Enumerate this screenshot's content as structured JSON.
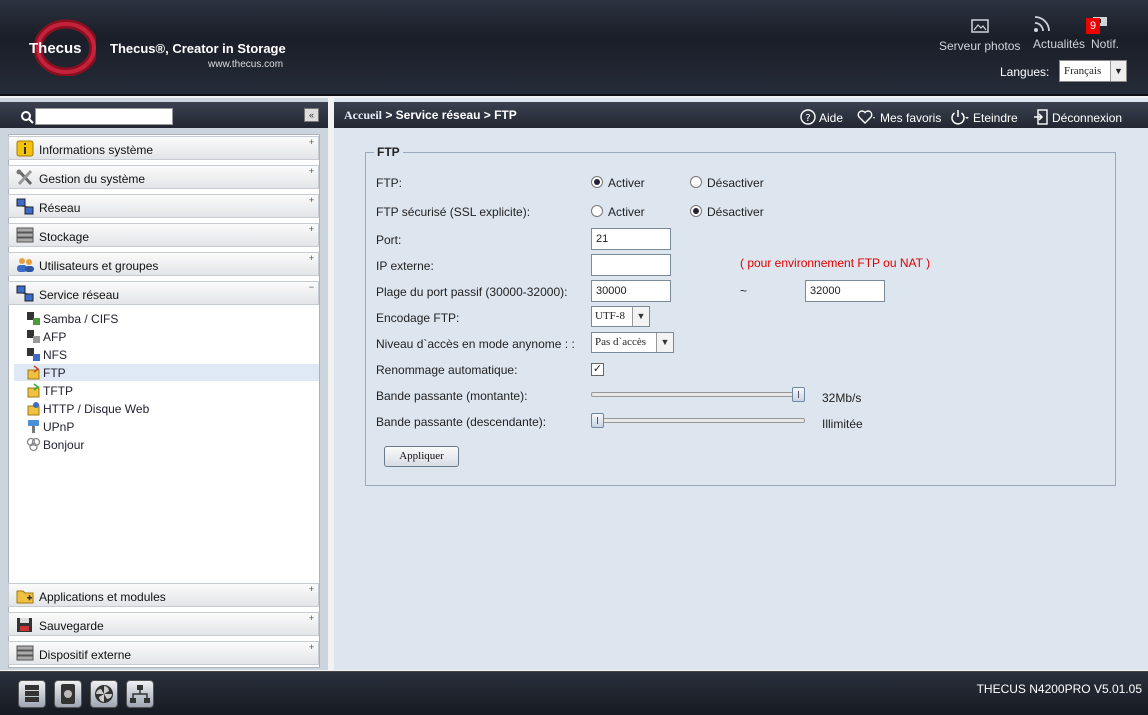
{
  "header": {
    "logo": "Thecus",
    "tagline": "Thecus®, Creator in Storage",
    "website": "www.thecus.com",
    "photo_server": "Serveur photos",
    "news": "Actualités",
    "notifications": "Notif.",
    "notif_count": "9",
    "lang_label": "Langues:",
    "lang_value": "Français"
  },
  "sidebar": {
    "search_placeholder": "",
    "categories_top": [
      {
        "label": "Informations système",
        "toggle": "+"
      },
      {
        "label": "Gestion du système",
        "toggle": "+"
      },
      {
        "label": "Réseau",
        "toggle": "+"
      },
      {
        "label": "Stockage",
        "toggle": "+"
      },
      {
        "label": "Utilisateurs et groupes",
        "toggle": "+"
      },
      {
        "label": "Service réseau",
        "toggle": "−"
      }
    ],
    "subitems": [
      {
        "label": "Samba / CIFS"
      },
      {
        "label": "AFP"
      },
      {
        "label": "NFS"
      },
      {
        "label": "FTP"
      },
      {
        "label": "TFTP"
      },
      {
        "label": "HTTP / Disque Web"
      },
      {
        "label": "UPnP"
      },
      {
        "label": "Bonjour"
      }
    ],
    "categories_bottom": [
      {
        "label": "Applications et modules",
        "toggle": "+"
      },
      {
        "label": "Sauvegarde",
        "toggle": "+"
      },
      {
        "label": "Dispositif externe",
        "toggle": "+"
      }
    ]
  },
  "breadcrumb": {
    "home": "Accueil",
    "path": " > Service réseau > FTP"
  },
  "toolbar": {
    "help": "Aide",
    "favorites": "Mes favoris",
    "shutdown": "Eteindre",
    "logout": "Déconnexion"
  },
  "form": {
    "legend": "FTP",
    "ftp_label": "FTP:",
    "ftp_on": "Activer",
    "ftp_off": "Désactiver",
    "ssl_label": "FTP sécurisé (SSL explicite):",
    "ssl_on": "Activer",
    "ssl_off": "Désactiver",
    "port_label": "Port:",
    "port_value": "21",
    "ip_label": "IP externe:",
    "ip_value": "",
    "ip_note": "( pour environnement FTP ou NAT )",
    "passive_label": "Plage du port passif (30000-32000):",
    "passive_from": "30000",
    "passive_sep": "~",
    "passive_to": "32000",
    "encoding_label": "Encodage FTP:",
    "encoding_value": "UTF-8",
    "anon_label": "Niveau d`accès en mode anynome : :",
    "anon_value": "Pas d`accès",
    "rename_label": "Renommage automatique:",
    "rename_checked": "✓",
    "up_label": "Bande passante (montante):",
    "up_value": "32Mb/s",
    "up_level": 1.0,
    "down_label": "Bande passante (descendante):",
    "down_value": "Illimitée",
    "down_level": 0.0,
    "apply": "Appliquer"
  },
  "footer": {
    "version": "THECUS N4200PRO V5.01.05"
  }
}
